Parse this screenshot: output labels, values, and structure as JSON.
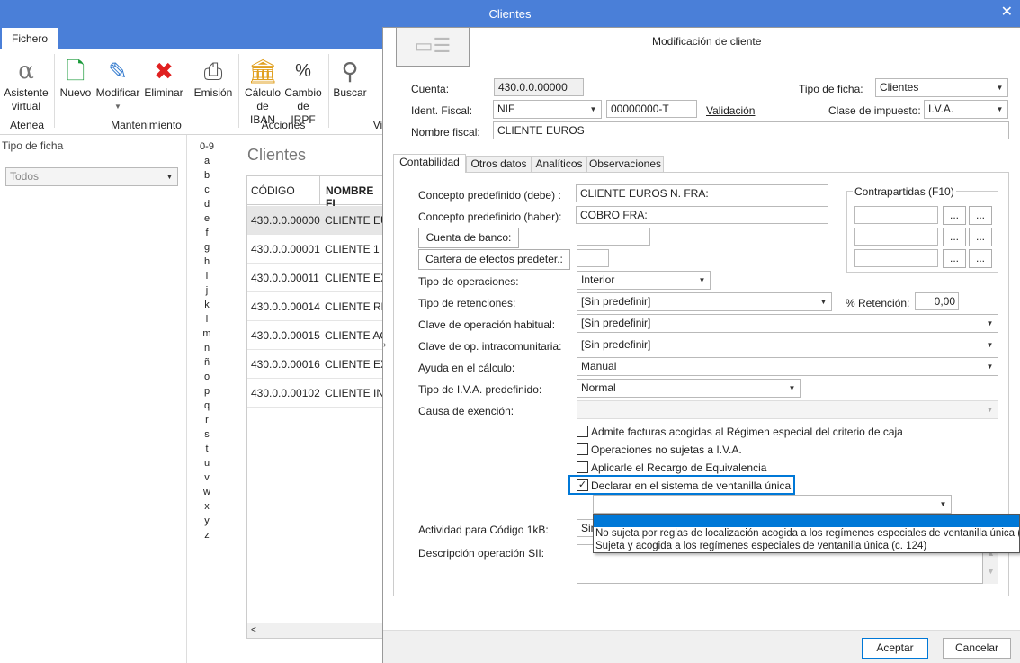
{
  "window": {
    "title": "Clientes",
    "close": "✕"
  },
  "ribbon": {
    "tab": "Fichero",
    "buttons": [
      {
        "label": "Asistente virtual",
        "icon": "alpha-icon"
      },
      {
        "label": "Nuevo",
        "icon": "new-doc-icon"
      },
      {
        "label": "Modificar",
        "icon": "edit-doc-icon"
      },
      {
        "label": "Eliminar",
        "icon": "delete-doc-icon"
      },
      {
        "label": "Emisión",
        "icon": "print-icon"
      },
      {
        "label": "Cálculo de IBAN",
        "icon": "bank-icon"
      },
      {
        "label": "Cambio de IRPF",
        "icon": "percent-icon"
      },
      {
        "label": "Buscar",
        "icon": "binoculars-icon"
      }
    ],
    "groups": [
      "Atenea",
      "Mantenimiento",
      "Acciones",
      "Vi"
    ]
  },
  "left": {
    "label": "Tipo de ficha",
    "filter": "Todos"
  },
  "alphabet": [
    "0-9",
    "a",
    "b",
    "c",
    "d",
    "e",
    "f",
    "g",
    "h",
    "i",
    "j",
    "k",
    "l",
    "m",
    "n",
    "ñ",
    "o",
    "p",
    "q",
    "r",
    "s",
    "t",
    "u",
    "v",
    "w",
    "x",
    "y",
    "z"
  ],
  "list": {
    "title": "Clientes",
    "headers": [
      "CÓDIGO",
      "NOMBRE FI"
    ],
    "rows": [
      [
        "430.0.0.00000",
        "CLIENTE EUR"
      ],
      [
        "430.0.0.00001",
        "CLIENTE 1"
      ],
      [
        "430.0.0.00011",
        "CLIENTE EXT"
      ],
      [
        "430.0.0.00014",
        "CLIENTE RET"
      ],
      [
        "430.0.0.00015",
        "CLIENTE AG"
      ],
      [
        "430.0.0.00016",
        "CLIENTE EXT"
      ],
      [
        "430.0.0.00102",
        "CLIENTE INT"
      ]
    ]
  },
  "dialog": {
    "title": "Modificación de cliente",
    "cuenta_label": "Cuenta:",
    "cuenta": "430.0.0.00000",
    "tipo_ficha_label": "Tipo de ficha:",
    "tipo_ficha": "Clientes",
    "ident_label": "Ident. Fiscal:",
    "ident_tipo": "NIF",
    "ident": "00000000-T",
    "validacion": "Validación",
    "clase_label": "Clase de impuesto:",
    "clase": "I.V.A.",
    "nombre_label": "Nombre fiscal:",
    "nombre": "CLIENTE EUROS",
    "tabs": [
      "Contabilidad",
      "Otros datos",
      "Analíticos",
      "Observaciones"
    ],
    "concepto_debe_label": "Concepto predefinido (debe) :",
    "concepto_debe": "CLIENTE EUROS N. FRA:",
    "concepto_haber_label": "Concepto predefinido (haber):",
    "concepto_haber": "COBRO FRA:",
    "cuenta_banco": "Cuenta de banco:",
    "cartera": "Cartera de efectos predeter.:",
    "contrapartidas": "Contrapartidas (F10)",
    "dots": "...",
    "tipo_op_label": "Tipo de operaciones:",
    "tipo_op": "Interior",
    "tipo_ret_label": "Tipo de retenciones:",
    "tipo_ret": "[Sin predefinir]",
    "ret_label": "% Retención:",
    "ret": "0,00",
    "clave_hab_label": "Clave de operación habitual:",
    "clave_hab": "[Sin predefinir]",
    "clave_intra_label": "Clave de op. intracomunitaria:",
    "clave_intra": "[Sin predefinir]",
    "ayuda_label": "Ayuda en el cálculo:",
    "ayuda": "Manual",
    "iva_label": "Tipo de I.V.A. predefinido:",
    "iva": "Normal",
    "causa_label": "Causa de exención:",
    "causa": "",
    "checks": [
      {
        "label": "Admite facturas acogidas al Régimen especial del criterio de caja",
        "checked": false
      },
      {
        "label": "Operaciones no sujetas a I.V.A.",
        "checked": false
      },
      {
        "label": "Aplicarle el Recargo de Equivalencia",
        "checked": false
      },
      {
        "label": "Declarar en el sistema de ventanilla única",
        "checked": true
      }
    ],
    "ventanilla_select": "",
    "dropdown_options": [
      "",
      "No sujeta por reglas de localización acogida a los regímenes especiales de ventanilla única (",
      "Sujeta y acogida a los regímenes especiales de ventanilla única (c. 124)"
    ],
    "actividad_label": "Actividad para Código 1kB:",
    "actividad": "Sin",
    "descripcion_label": "Descripción operación SII:",
    "aceptar": "Aceptar",
    "cancelar": "Cancelar"
  },
  "colors": {
    "title_bar": "#4a7fd8",
    "selection": "#0078d7"
  }
}
